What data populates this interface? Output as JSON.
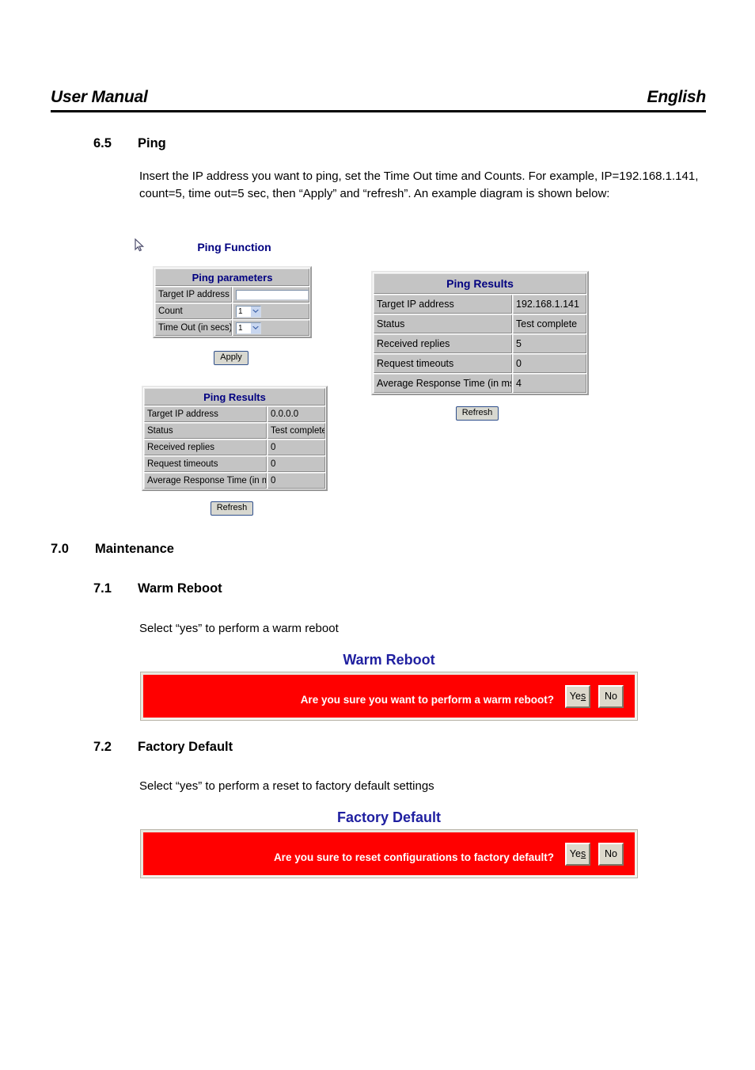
{
  "header": {
    "left": "User Manual",
    "right": "English"
  },
  "sections": {
    "ping": {
      "number": "6.5",
      "title": "Ping",
      "paragraph": "Insert the IP address you want to ping, set the Time Out time and Counts. For example, IP=192.168.1.141, count=5, time out=5 sec, then “Apply” and “refresh”. An example diagram is shown below:"
    },
    "maintenance": {
      "number": "7.0",
      "title": "Maintenance"
    },
    "warm_reboot": {
      "number": "7.1",
      "title": "Warm Reboot",
      "paragraph": "Select “yes” to perform a warm reboot"
    },
    "factory_default": {
      "number": "7.2",
      "title": "Factory Default",
      "paragraph": "Select “yes” to perform a reset to factory default settings"
    }
  },
  "ping_function": {
    "title": "Ping Function",
    "parameters_table": {
      "caption": "Ping parameters",
      "rows": [
        {
          "label": "Target IP address",
          "value": ""
        },
        {
          "label": "Count",
          "value": "1"
        },
        {
          "label": "Time Out (in secs)",
          "value": "1"
        }
      ]
    },
    "apply_button": "Apply"
  },
  "ping_results_left": {
    "caption": "Ping Results",
    "rows": [
      {
        "label": "Target IP address",
        "value": "0.0.0.0"
      },
      {
        "label": "Status",
        "value": "Test complete"
      },
      {
        "label": "Received replies",
        "value": "0"
      },
      {
        "label": "Request timeouts",
        "value": "0"
      },
      {
        "label": "Average Response Time (in ms)",
        "value": "0"
      }
    ],
    "refresh_button": "Refresh"
  },
  "ping_results_right": {
    "caption": "Ping Results",
    "rows": [
      {
        "label": "Target IP address",
        "value": "192.168.1.141"
      },
      {
        "label": "Status",
        "value": "Test complete"
      },
      {
        "label": "Received replies",
        "value": "5"
      },
      {
        "label": "Request timeouts",
        "value": "0"
      },
      {
        "label": "Average Response Time (in ms)",
        "value": "4"
      }
    ],
    "refresh_button": "Refresh"
  },
  "warm_reboot_dialog": {
    "title": "Warm Reboot",
    "message": "Are you sure you want to perform a warm reboot?",
    "yes_label": "Yes",
    "no_label": "No"
  },
  "factory_default_dialog": {
    "title": "Factory Default",
    "message": "Are you sure to reset configurations to factory default?",
    "yes_label": "Yes",
    "no_label": "No"
  },
  "colors": {
    "heading_blue": "#000080",
    "alert_red": "#ff0000",
    "alert_title_blue": "#1f1fa0",
    "table_grey": "#c4c4c4"
  }
}
